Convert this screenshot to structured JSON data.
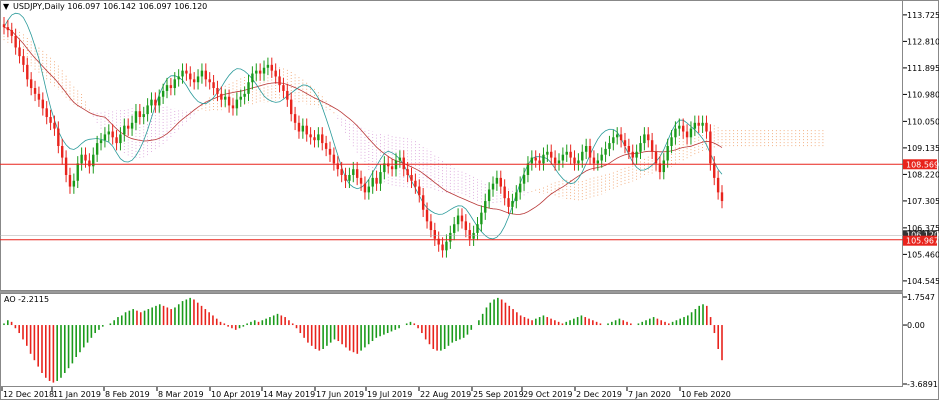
{
  "symbol_header": "USDJPY,Daily  106.097 106.142 106.097 106.120",
  "indicator_header": "AO -2.2115",
  "price_axis": [
    "113.725",
    "112.810",
    "111.895",
    "110.980",
    "110.050",
    "109.135",
    "108.220",
    "107.305",
    "106.375",
    "105.460",
    "104.545"
  ],
  "price_tags": {
    "resistance": "108.569",
    "current": "105.967",
    "bid": "106.120"
  },
  "ao_axis": [
    "1.7547",
    "0.00",
    "-3.6891"
  ],
  "date_axis": [
    "12 Dec 2018",
    "11 Jan 2019",
    "8 Feb 2019",
    "8 Mar 2019",
    "10 Apr 2019",
    "14 May 2019",
    "17 Jun 2019",
    "19 Jul 2019",
    "22 Aug 2019",
    "25 Sep 2019",
    "29 Oct 2019",
    "2 Dec 2019",
    "7 Jan 2020",
    "10 Feb 2020"
  ],
  "colors": {
    "bull": "#1a9a1a",
    "bear": "#e8231c",
    "line": "#e8231c",
    "kijun": "#b83838",
    "tenkan": "#2a9a9a",
    "cloud_up": "#f0a06a",
    "cloud_dn": "#d9a0d9",
    "grid": "#dddddd"
  },
  "chart_data": {
    "type": "candlestick",
    "symbol": "USDJPY",
    "timeframe": "Daily",
    "ylim": [
      104.3,
      114.1
    ],
    "closes": [
      113.3,
      113.2,
      113.0,
      112.6,
      112.3,
      112.0,
      111.5,
      111.2,
      111.0,
      110.8,
      110.5,
      110.2,
      110.0,
      109.8,
      109.2,
      108.8,
      108.2,
      107.8,
      108.0,
      108.6,
      108.9,
      108.7,
      108.5,
      108.9,
      109.3,
      109.4,
      109.6,
      109.7,
      109.5,
      109.3,
      109.6,
      109.9,
      109.8,
      110.0,
      110.4,
      110.2,
      110.3,
      110.6,
      110.8,
      110.6,
      110.9,
      111.1,
      111.3,
      111.2,
      111.5,
      111.6,
      111.8,
      111.7,
      111.5,
      111.4,
      111.6,
      111.8,
      111.5,
      111.4,
      111.2,
      111.0,
      110.8,
      110.9,
      110.6,
      110.5,
      110.8,
      110.9,
      111.0,
      111.4,
      111.7,
      111.8,
      111.7,
      111.9,
      112.0,
      111.8,
      111.6,
      111.3,
      111.1,
      110.8,
      110.3,
      110.0,
      109.7,
      109.9,
      109.6,
      109.5,
      109.4,
      109.6,
      109.3,
      109.1,
      108.9,
      108.6,
      108.4,
      108.2,
      108.0,
      108.2,
      108.4,
      108.1,
      107.9,
      107.6,
      107.8,
      108.1,
      107.9,
      108.3,
      108.6,
      108.5,
      108.4,
      108.7,
      108.8,
      108.4,
      108.2,
      108.0,
      107.8,
      107.5,
      107.0,
      106.6,
      106.3,
      106.0,
      105.8,
      105.6,
      105.9,
      106.2,
      106.5,
      106.8,
      106.6,
      106.3,
      106.0,
      106.2,
      106.5,
      106.9,
      107.3,
      107.7,
      107.9,
      108.1,
      107.8,
      107.4,
      107.1,
      107.3,
      107.6,
      107.9,
      108.2,
      108.6,
      108.8,
      108.7,
      108.6,
      108.9,
      109.0,
      108.8,
      108.6,
      108.7,
      108.9,
      109.0,
      108.8,
      108.6,
      108.7,
      109.0,
      109.2,
      108.8,
      108.6,
      108.7,
      108.9,
      109.1,
      109.3,
      109.5,
      109.6,
      109.4,
      109.2,
      109.0,
      108.8,
      109.0,
      109.3,
      109.6,
      109.4,
      109.0,
      108.6,
      108.3,
      108.7,
      109.2,
      109.5,
      109.8,
      109.9,
      109.7,
      109.5,
      109.8,
      110.0,
      109.9,
      110.0,
      109.7,
      108.6,
      108.1,
      107.6,
      107.3
    ],
    "indicators": [
      "Ichimoku Kinko Hyo",
      "Awesome Oscillator"
    ],
    "ao_ylim": [
      -3.6891,
      1.7547
    ],
    "ao_values": [
      0.1,
      0.3,
      0.2,
      -0.2,
      -0.5,
      -0.9,
      -1.3,
      -1.8,
      -2.2,
      -2.6,
      -3.0,
      -3.3,
      -3.5,
      -3.6,
      -3.5,
      -3.3,
      -3.0,
      -2.7,
      -2.4,
      -2.0,
      -1.7,
      -1.4,
      -1.1,
      -0.8,
      -0.5,
      -0.3,
      -0.1,
      0.0,
      0.1,
      0.3,
      0.5,
      0.6,
      0.8,
      0.9,
      1.0,
      0.9,
      0.8,
      0.9,
      1.0,
      1.1,
      1.2,
      1.3,
      1.2,
      1.1,
      1.0,
      1.1,
      1.3,
      1.5,
      1.6,
      1.7,
      1.6,
      1.4,
      1.2,
      1.0,
      0.8,
      0.6,
      0.4,
      0.2,
      0.1,
      -0.1,
      -0.2,
      -0.3,
      -0.2,
      -0.1,
      0.1,
      0.2,
      0.3,
      0.2,
      0.3,
      0.4,
      0.5,
      0.6,
      0.7,
      0.6,
      0.5,
      0.3,
      0.1,
      -0.2,
      -0.5,
      -0.8,
      -1.1,
      -1.3,
      -1.5,
      -1.6,
      -1.5,
      -1.3,
      -1.1,
      -0.9,
      -1.0,
      -1.2,
      -1.4,
      -1.6,
      -1.7,
      -1.8,
      -1.6,
      -1.4,
      -1.2,
      -1.0,
      -0.8,
      -0.7,
      -0.6,
      -0.5,
      -0.4,
      -0.3,
      -0.2,
      0.0,
      0.1,
      0.2,
      0.1,
      -0.2,
      -0.5,
      -0.9,
      -1.2,
      -1.5,
      -1.6,
      -1.6,
      -1.5,
      -1.3,
      -1.1,
      -1.0,
      -0.9,
      -0.8,
      -0.6,
      -0.3,
      0.0,
      0.3,
      0.7,
      1.1,
      1.4,
      1.6,
      1.7,
      1.6,
      1.4,
      1.2,
      1.0,
      0.8,
      0.6,
      0.5,
      0.4,
      0.3,
      0.4,
      0.5,
      0.6,
      0.5,
      0.4,
      0.3,
      0.2,
      0.1,
      0.2,
      0.3,
      0.4,
      0.5,
      0.6,
      0.5,
      0.4,
      0.3,
      0.2,
      0.1,
      0.0,
      0.1,
      0.2,
      0.3,
      0.4,
      0.3,
      0.2,
      0.1,
      0.0,
      0.1,
      0.2,
      0.3,
      0.4,
      0.5,
      0.4,
      0.3,
      0.2,
      0.1,
      0.2,
      0.3,
      0.4,
      0.5,
      0.6,
      0.8,
      1.0,
      1.2,
      1.3,
      1.2,
      0.5,
      -0.5,
      -1.5,
      -2.2
    ]
  }
}
